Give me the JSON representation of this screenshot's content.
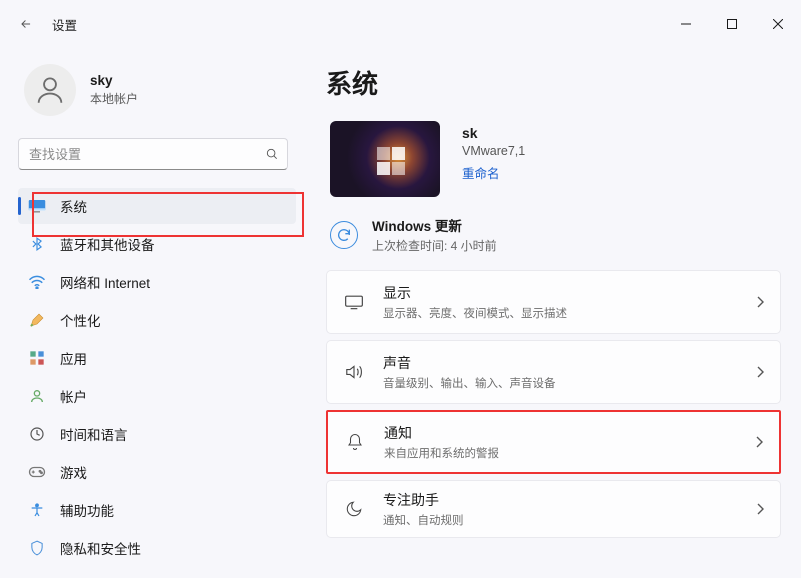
{
  "window": {
    "title": "设置"
  },
  "user": {
    "name": "sky",
    "account_type": "本地帐户"
  },
  "search": {
    "placeholder": "查找设置"
  },
  "sidebar": {
    "items": [
      {
        "label": "系统",
        "icon": "system-icon",
        "active": true,
        "highlighted": true
      },
      {
        "label": "蓝牙和其他设备",
        "icon": "bluetooth-icon"
      },
      {
        "label": "网络和 Internet",
        "icon": "wifi-icon"
      },
      {
        "label": "个性化",
        "icon": "personalize-icon"
      },
      {
        "label": "应用",
        "icon": "apps-icon"
      },
      {
        "label": "帐户",
        "icon": "account-icon"
      },
      {
        "label": "时间和语言",
        "icon": "time-lang-icon"
      },
      {
        "label": "游戏",
        "icon": "gaming-icon"
      },
      {
        "label": "辅助功能",
        "icon": "accessibility-icon"
      },
      {
        "label": "隐私和安全性",
        "icon": "privacy-icon"
      }
    ]
  },
  "main": {
    "title": "系统",
    "device": {
      "name": "sk",
      "model": "VMware7,1",
      "rename_label": "重命名"
    },
    "update": {
      "title": "Windows 更新",
      "subtitle": "上次检查时间: 4 小时前"
    },
    "cards": [
      {
        "id": "display",
        "title": "显示",
        "subtitle": "显示器、亮度、夜间模式、显示描述"
      },
      {
        "id": "sound",
        "title": "声音",
        "subtitle": "音量级别、输出、输入、声音设备"
      },
      {
        "id": "notifications",
        "title": "通知",
        "subtitle": "来自应用和系统的警报",
        "highlighted": true
      },
      {
        "id": "focus-assist",
        "title": "专注助手",
        "subtitle": "通知、自动规则"
      }
    ]
  }
}
